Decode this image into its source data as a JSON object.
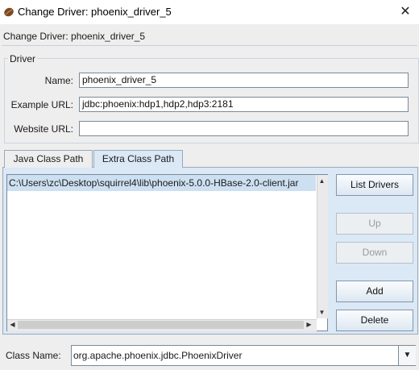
{
  "window": {
    "title": "Change Driver: phoenix_driver_5",
    "close_icon": "close-icon",
    "app_icon": "coffee-bean-icon"
  },
  "header": {
    "title": "Change Driver: phoenix_driver_5"
  },
  "driver": {
    "legend": "Driver",
    "name_label": "Name:",
    "name_value": "phoenix_driver_5",
    "example_url_label": "Example URL:",
    "example_url_value": "jdbc:phoenix:hdp1,hdp2,hdp3:2181",
    "website_url_label": "Website URL:",
    "website_url_value": ""
  },
  "tabs": [
    {
      "label": "Java Class Path",
      "selected": false
    },
    {
      "label": "Extra Class Path",
      "selected": true
    }
  ],
  "class_path_list": {
    "items": [
      "C:\\Users\\zc\\Desktop\\squirrel4\\lib\\phoenix-5.0.0-HBase-2.0-client.jar"
    ],
    "selected_index": 0
  },
  "buttons": {
    "list_drivers": "List Drivers",
    "up": "Up",
    "down": "Down",
    "add": "Add",
    "delete": "Delete"
  },
  "class_name": {
    "label": "Class Name:",
    "value": "org.apache.phoenix.jdbc.PhoenixDriver"
  },
  "colors": {
    "tab_selected_bg": "#dbe8f5",
    "selection_bg": "#cde0f2",
    "panel_bg": "#eeeeee"
  }
}
